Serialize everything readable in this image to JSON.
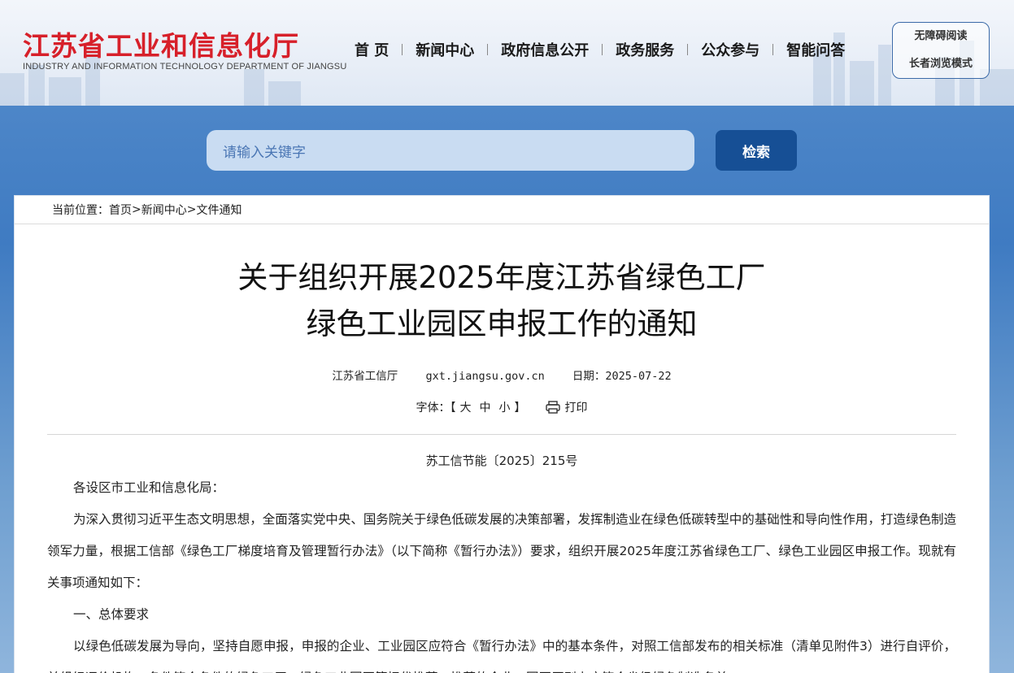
{
  "header": {
    "logo_cn": "江苏省工业和信息化厅",
    "logo_en": "INDUSTRY AND INFORMATION TECHNOLOGY DEPARTMENT OF JIANGSU",
    "nav": [
      "首 页",
      "新闻中心",
      "政府信息公开",
      "政务服务",
      "公众参与",
      "智能问答"
    ],
    "accessibility": "无障碍阅读",
    "elder_mode": "长者浏览模式"
  },
  "search": {
    "placeholder": "请输入关键字",
    "button": "检索"
  },
  "breadcrumb": {
    "label": "当前位置：",
    "items": [
      "首页",
      "新闻中心",
      "文件通知"
    ],
    "separator": ">"
  },
  "article": {
    "title_line1": "关于组织开展2025年度江苏省绿色工厂",
    "title_line2": "绿色工业园区申报工作的通知",
    "source": "江苏省工信厅",
    "site": "gxt.jiangsu.gov.cn",
    "date_label": "日期：",
    "date": "2025-07-22",
    "font_label": "字体：【",
    "font_large": "大",
    "font_medium": "中",
    "font_small": "小",
    "font_end": "】",
    "print": "打印",
    "doc_no": "苏工信节能〔2025〕215号",
    "paragraphs": [
      "各设区市工业和信息化局：",
      "为深入贯彻习近平生态文明思想，全面落实党中央、国务院关于绿色低碳发展的决策部署，发挥制造业在绿色低碳转型中的基础性和导向性作用，打造绿色制造领军力量，根据工信部《绿色工厂梯度培育及管理暂行办法》（以下简称《暂行办法》）要求，组织开展2025年度江苏省绿色工厂、绿色工业园区申报工作。现就有关事项通知如下：",
      "一、总体要求",
      "以绿色低碳发展为导向，坚持自愿申报，申报的企业、工业园区应符合《暂行办法》中的基本条件，对照工信部发布的相关标准（清单见附件3）进行自评价，并组织评价机构，条件符合条件的绿色工厂、绿色工业园区等择优推荐，推荐的企业、园区原则上应符合省级绿色制造名单。"
    ]
  },
  "colors": {
    "logo_red": "#d7202a",
    "search_button": "#164f95",
    "search_field": "#c9dcf2",
    "band": "#4d86c8"
  }
}
